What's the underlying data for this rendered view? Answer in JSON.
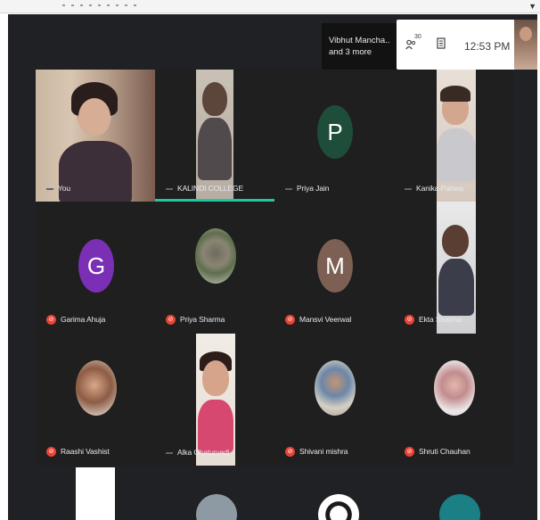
{
  "meeting": {
    "presenter_chip": "Vibhut Mancha... and 3 more",
    "presenter_line1": "Vibhut Mancha..",
    "presenter_line2": "and 3 more",
    "participant_count": "30",
    "time": "12:53 PM"
  },
  "colors": {
    "background": "#202124",
    "tile": "#1f1f1f",
    "active_speaker": "#1fc8a0",
    "muted": "#ea4335"
  },
  "participants": [
    {
      "name": "You",
      "muted": false,
      "type": "video"
    },
    {
      "name": "KALINDI COLLEGE",
      "muted": false,
      "type": "video",
      "speaking": true
    },
    {
      "name": "Priya Jain",
      "muted": false,
      "type": "initial",
      "initial": "P",
      "color": "#1e4d3a"
    },
    {
      "name": "Kanika Pahwa",
      "muted": false,
      "type": "video"
    },
    {
      "name": "Garima Ahuja",
      "muted": true,
      "type": "initial",
      "initial": "G",
      "color": "#7b2fb5"
    },
    {
      "name": "Priya Sharma",
      "muted": true,
      "type": "photo"
    },
    {
      "name": "Mansvi Veerwal",
      "muted": true,
      "type": "initial",
      "initial": "M",
      "color": "#7d6054"
    },
    {
      "name": "Ekta Sharma",
      "muted": true,
      "type": "video"
    },
    {
      "name": "Raashi Vashist",
      "muted": true,
      "type": "photo"
    },
    {
      "name": "Alka Chaturvedi",
      "muted": false,
      "type": "video"
    },
    {
      "name": "Shivani mishra",
      "muted": true,
      "type": "photo"
    },
    {
      "name": "Shruti Chauhan",
      "muted": true,
      "type": "photo"
    }
  ]
}
